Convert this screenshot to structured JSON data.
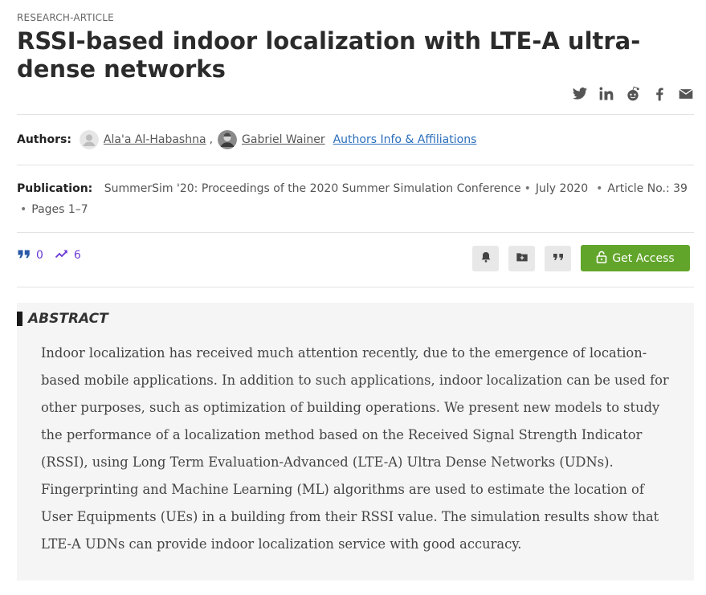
{
  "article_type": "RESEARCH-ARTICLE",
  "title": "RSSI-based indoor localization with LTE-A ultra-dense networks",
  "share_icons": [
    "twitter-icon",
    "linkedin-icon",
    "reddit-icon",
    "facebook-icon",
    "email-icon"
  ],
  "authors": {
    "label": "Authors:",
    "list": [
      {
        "name": "Ala'a Al-Habashna",
        "separator": ","
      },
      {
        "name": "Gabriel Wainer",
        "separator": ""
      }
    ],
    "info_link": "Authors Info & Affiliations"
  },
  "publication": {
    "label": "Publication:",
    "venue": "SummerSim '20: Proceedings of the 2020 Summer Simulation Conference",
    "date": "July 2020",
    "article_no": "Article No.: 39",
    "pages": "Pages 1–7"
  },
  "metrics": {
    "citations": "0",
    "downloads": "6"
  },
  "actions": {
    "get_access": "Get Access"
  },
  "abstract": {
    "heading": "ABSTRACT",
    "text": "Indoor localization has received much attention recently, due to the emergence of location-based mobile applications. In addition to such applications, indoor localization can be used for other purposes, such as optimization of building operations. We present new models to study the performance of a localization method based on the Received Signal Strength Indicator (RSSI), using Long Term Evaluation-Advanced (LTE-A) Ultra Dense Networks (UDNs). Fingerprinting and Machine Learning (ML) algorithms are used to estimate the location of User Equipments (UEs) in a building from their RSSI value. The simulation results show that LTE-A UDNs can provide indoor localization service with good accuracy."
  },
  "colors": {
    "accent_green": "#62a52b",
    "link_blue": "#2a6ebb",
    "metric_purple": "#6b3bd6",
    "abstract_bg": "#f5f5f5"
  }
}
